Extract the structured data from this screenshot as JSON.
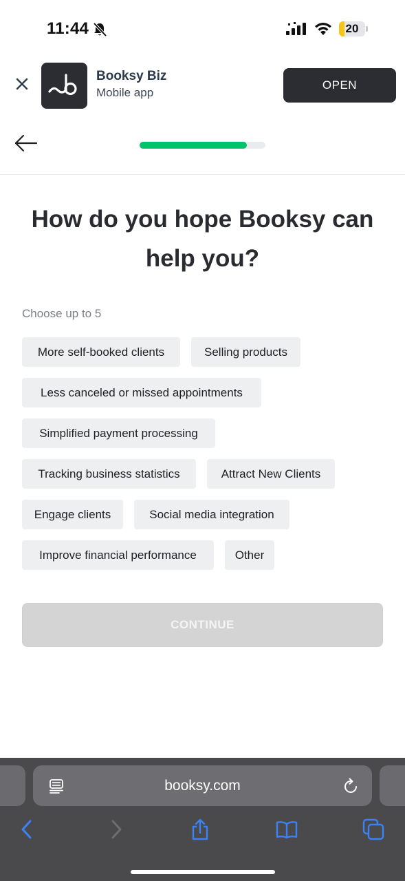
{
  "status_bar": {
    "time": "11:44",
    "battery": "20",
    "battery_level": 0.2
  },
  "app_banner": {
    "name": "Booksy Biz",
    "subtitle": "Mobile app",
    "open_label": "OPEN"
  },
  "progress": {
    "fraction": 0.85,
    "color": "#00c36b"
  },
  "question": {
    "title": "How do you hope Booksy can help you?",
    "hint": "Choose up to 5"
  },
  "options": [
    "More self-booked clients",
    "Selling products",
    "Less canceled or missed appointments",
    "Simplified payment processing",
    "Tracking business statistics",
    "Attract New Clients",
    "Engage clients",
    "Social media integration",
    "Improve financial performance",
    "Other"
  ],
  "continue_label": "CONTINUE",
  "browser": {
    "url": "booksy.com"
  },
  "icons": {
    "back": "arrow-left-icon",
    "close": "close-icon",
    "reader": "reader-mode-icon",
    "reload": "reload-icon",
    "toolbar": [
      "chevron-left-icon",
      "chevron-right-icon",
      "share-icon",
      "bookmarks-icon",
      "tabs-icon"
    ]
  },
  "colors": {
    "accent_green": "#00c36b",
    "banner_dark": "#2b2d33",
    "chip_bg": "#eeeff0",
    "browser_link_blue": "#3b82f6"
  }
}
